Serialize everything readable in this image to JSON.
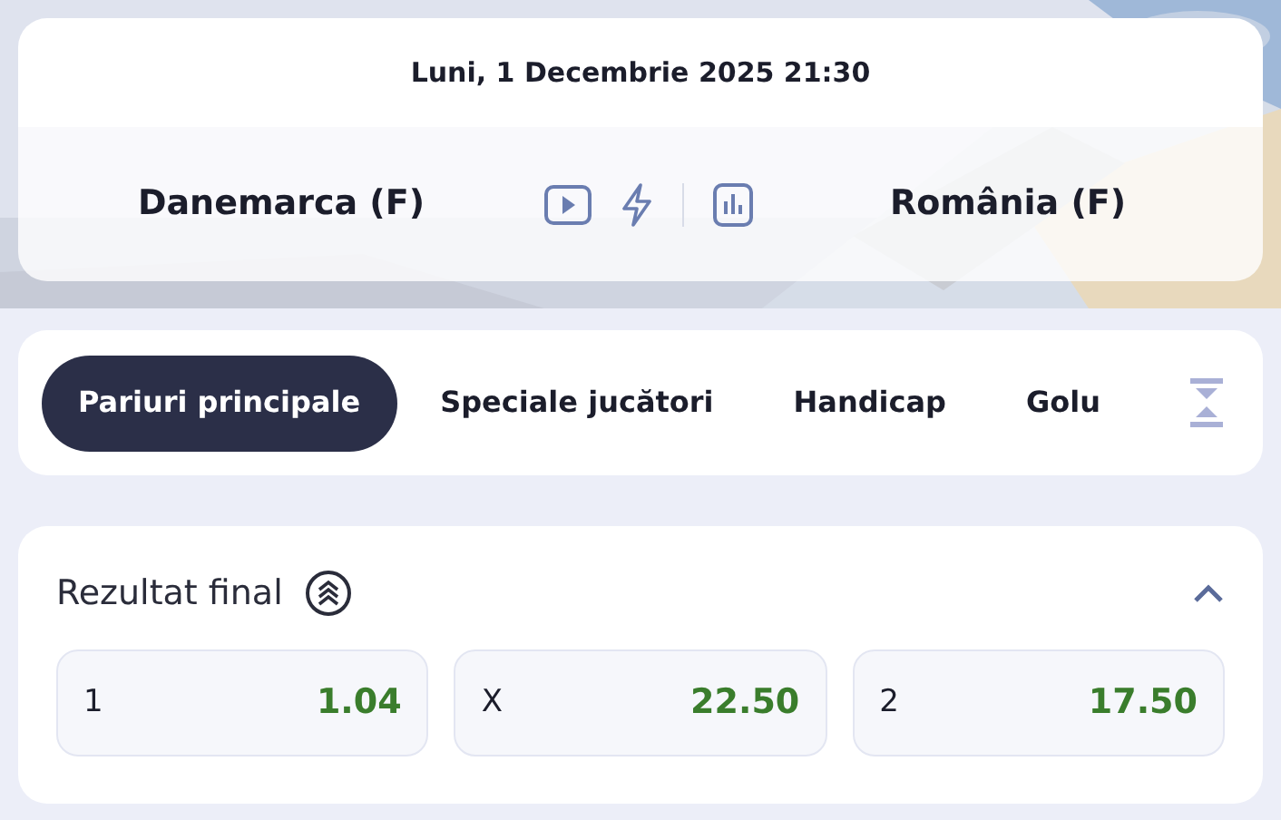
{
  "header": {
    "kind": "picture",
    "date": "Luni, 1 Decembrie 2025 21:30",
    "home_team": "Danemarca (F)",
    "away_team": "România (F)"
  },
  "tabs": [
    {
      "label": "Pariuri principale",
      "selected": true
    },
    {
      "label": "Speciale jucători",
      "selected": false
    },
    {
      "label": "Handicap",
      "selected": false
    },
    {
      "label": "Golu",
      "selected": false
    }
  ],
  "market": {
    "title": "Rezultat final",
    "expanded": true,
    "odds": [
      {
        "label": "1",
        "value": "1.04"
      },
      {
        "label": "X",
        "value": "22.50"
      },
      {
        "label": "2",
        "value": "17.50"
      }
    ]
  }
}
